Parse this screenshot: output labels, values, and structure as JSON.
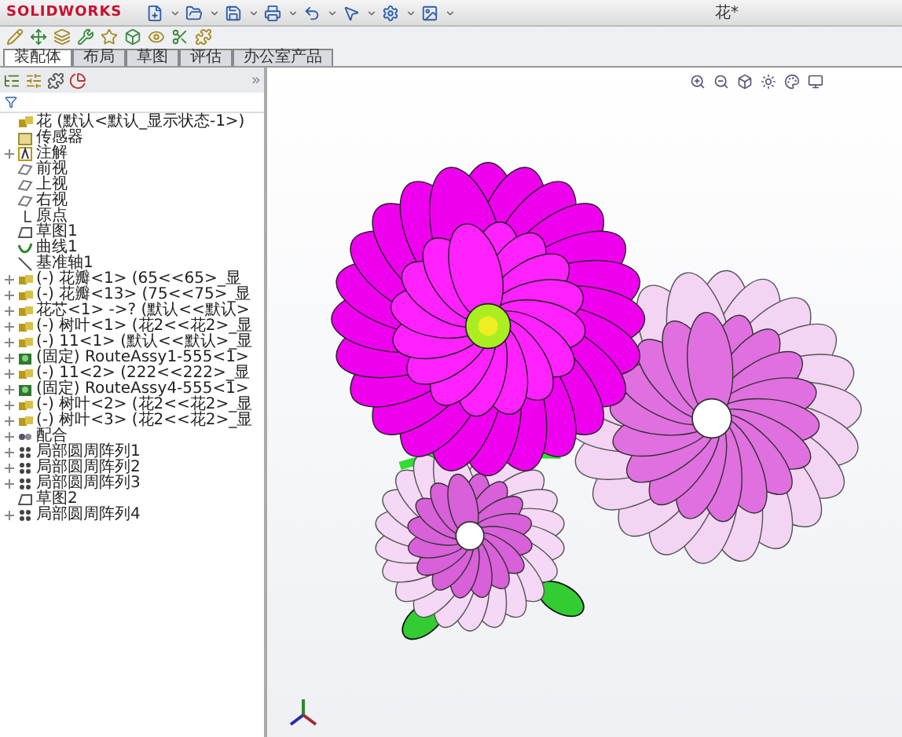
{
  "app_logo": "SOLIDWORKS",
  "window": {
    "title": "花*"
  },
  "command_tabs": [
    {
      "label": "装配体",
      "selected": true
    },
    {
      "label": "布局",
      "selected": false
    },
    {
      "label": "草图",
      "selected": false
    },
    {
      "label": "评估",
      "selected": false
    },
    {
      "label": "办公室产品",
      "selected": false
    }
  ],
  "panel_more": "»",
  "tree": [
    {
      "label": "花 (默认<默认_显示状态-1>)",
      "kind": "assembly",
      "expandable": false
    },
    {
      "label": "传感器",
      "kind": "sensor",
      "expandable": false
    },
    {
      "label": "注解",
      "kind": "annotation",
      "expandable": true
    },
    {
      "label": "前视",
      "kind": "plane",
      "expandable": false
    },
    {
      "label": "上视",
      "kind": "plane",
      "expandable": false
    },
    {
      "label": "右视",
      "kind": "plane",
      "expandable": false
    },
    {
      "label": "原点",
      "kind": "origin",
      "expandable": false
    },
    {
      "label": "草图1",
      "kind": "sketch",
      "expandable": false
    },
    {
      "label": "曲线1",
      "kind": "curve",
      "expandable": false
    },
    {
      "label": "基准轴1",
      "kind": "axis",
      "expandable": false
    },
    {
      "label": "(-) 花瓣<1> (65<<65>_显",
      "kind": "part",
      "expandable": true
    },
    {
      "label": "(-) 花瓣<13> (75<<75>_显",
      "kind": "part",
      "expandable": true
    },
    {
      "label": "花芯<1> ->? (默认<<默认>",
      "kind": "part",
      "expandable": true
    },
    {
      "label": "(-) 树叶<1> (花2<<花2>_显",
      "kind": "part",
      "expandable": true
    },
    {
      "label": "(-) 11<1> (默认<<默认>_显",
      "kind": "part",
      "expandable": true
    },
    {
      "label": "(固定) RouteAssy1-555<1>",
      "kind": "route",
      "expandable": true
    },
    {
      "label": "(-) 11<2> (222<<222>_显",
      "kind": "part",
      "expandable": true
    },
    {
      "label": "(固定) RouteAssy4-555<1>",
      "kind": "route",
      "expandable": true
    },
    {
      "label": "(-) 树叶<2> (花2<<花2>_显",
      "kind": "part",
      "expandable": true
    },
    {
      "label": "(-) 树叶<3> (花2<<花2>_显",
      "kind": "part",
      "expandable": true
    },
    {
      "label": "配合",
      "kind": "mates",
      "expandable": true
    },
    {
      "label": "局部圆周阵列1",
      "kind": "pattern",
      "expandable": true
    },
    {
      "label": "局部圆周阵列2",
      "kind": "pattern",
      "expandable": true
    },
    {
      "label": "局部圆周阵列3",
      "kind": "pattern",
      "expandable": true
    },
    {
      "label": "草图2",
      "kind": "sketch",
      "expandable": false
    },
    {
      "label": "局部圆周阵列4",
      "kind": "pattern",
      "expandable": true
    }
  ]
}
